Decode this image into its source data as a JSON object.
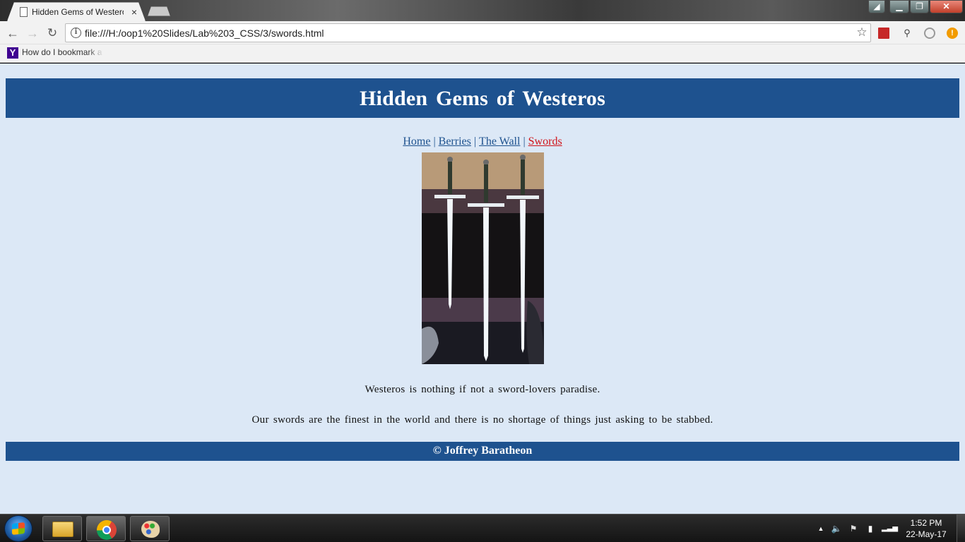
{
  "browser": {
    "tab_title": "Hidden Gems of Westeros",
    "tab_close": "×",
    "url": "file:///H:/oop1%20Slides/Lab%203_CSS/3/swords.html",
    "bookmark_label": "How do I bookmark a",
    "bookmark_icon_letter": "Y",
    "window_close_glyph": "✕",
    "window_max_glyph": "❐",
    "window_min_glyph": "▁",
    "window_user_glyph": "◢"
  },
  "page": {
    "title": "Hidden Gems of Westeros",
    "nav": {
      "home": "Home",
      "berries": "Berries",
      "the_wall": "The Wall",
      "swords": "Swords",
      "separator": "|"
    },
    "paragraph_1": "Westeros is nothing if not a sword-lovers paradise.",
    "paragraph_2": "Our swords are the finest in the world and there is no shortage of things just asking to be stabbed.",
    "footer": "© Joffrey Baratheon"
  },
  "taskbar": {
    "clock_time": "1:52 PM",
    "clock_date": "22-May-17"
  },
  "icons": {
    "back": "arrow-left-icon",
    "forward": "arrow-right-icon",
    "reload": "reload-icon",
    "info": "info-icon",
    "star": "star-icon",
    "search": "search-icon"
  },
  "colors": {
    "header_bg": "#1e528f",
    "page_bg": "#dce8f6",
    "nav_link": "#1e528f",
    "nav_current": "#d0141a"
  }
}
